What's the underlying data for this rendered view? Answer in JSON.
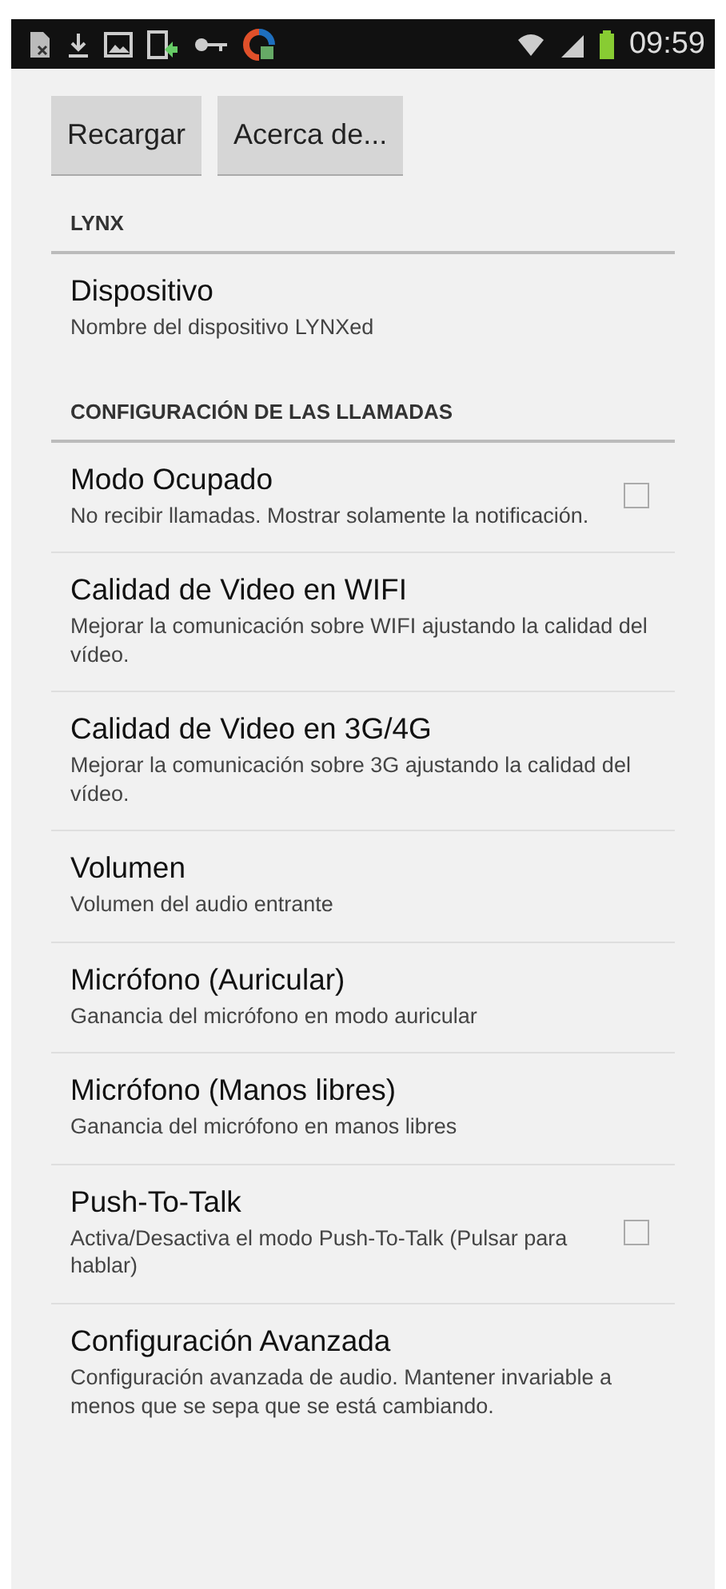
{
  "status_bar": {
    "time": "09:59"
  },
  "buttons": [
    {
      "label": "Recargar"
    },
    {
      "label": "Acerca de..."
    }
  ],
  "sections": [
    {
      "title": "LYNX",
      "items": [
        {
          "kind": "plain",
          "title": "Dispositivo",
          "summary": "Nombre del dispositivo LYNXed"
        }
      ]
    },
    {
      "title": "CONFIGURACIÓN DE LAS LLAMADAS",
      "items": [
        {
          "kind": "checkbox",
          "title": "Modo Ocupado",
          "summary": "No recibir llamadas. Mostrar solamente la notificación.",
          "checked": false
        },
        {
          "kind": "plain",
          "title": "Calidad de Video en WIFI",
          "summary": "Mejorar la comunicación sobre WIFI ajustando la calidad del vídeo."
        },
        {
          "kind": "plain",
          "title": "Calidad de Video en 3G/4G",
          "summary": "Mejorar la comunicación sobre 3G ajustando la calidad del vídeo."
        },
        {
          "kind": "plain",
          "title": "Volumen",
          "summary": "Volumen del audio entrante"
        },
        {
          "kind": "plain",
          "title": "Micrófono (Auricular)",
          "summary": "Ganancia del micrófono en modo auricular"
        },
        {
          "kind": "plain",
          "title": "Micrófono (Manos libres)",
          "summary": "Ganancia del micrófono en manos libres"
        },
        {
          "kind": "checkbox",
          "title": "Push-To-Talk",
          "summary": "Activa/Desactiva el modo Push-To-Talk (Pulsar para hablar)",
          "checked": false
        },
        {
          "kind": "plain",
          "title": "Configuración Avanzada",
          "summary": "Configuración avanzada de audio. Mantener invariable a menos que se sepa que se está cambiando."
        }
      ]
    }
  ]
}
